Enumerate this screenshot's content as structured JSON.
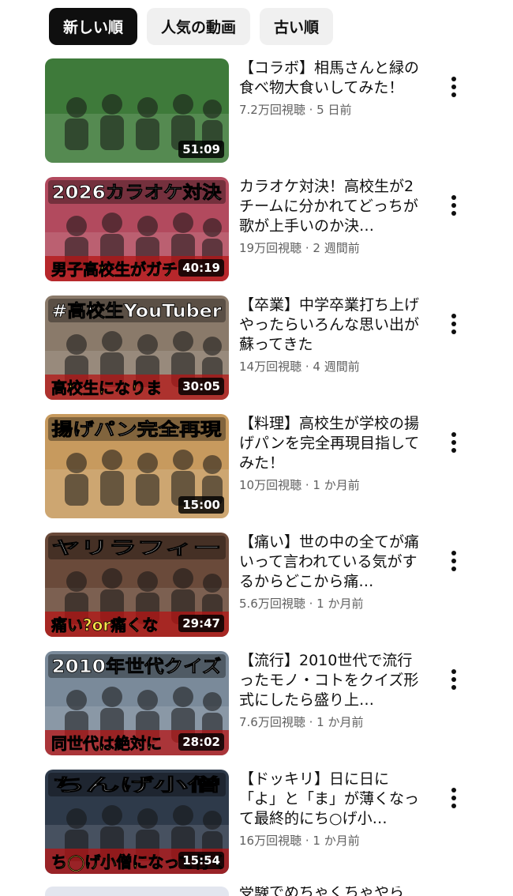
{
  "filters": [
    {
      "label": "新しい順",
      "active": true
    },
    {
      "label": "人気の動画",
      "active": false
    },
    {
      "label": "古い順",
      "active": false
    }
  ],
  "videos": [
    {
      "title": "【コラボ】相馬さんと緑の食べ物大食いしてみた！",
      "views": "7.2万回視聴",
      "age": "5 日前",
      "duration": "51:09",
      "thumb_text": "",
      "thumb_bg": "#3e7a3a"
    },
    {
      "title": "カラオケ対決！高校生が2チームに分かれてどっちが歌が上手いのか決…",
      "views": "19万回視聴",
      "age": "2 週間前",
      "duration": "40:19",
      "thumb_text": "2026カラオケ対決",
      "thumb_bottom": "男子高校生がガチ",
      "thumb_bg": "#b24a5e"
    },
    {
      "title": "【卒業】中学卒業打ち上げやったらいろんな思い出が蘇ってきた",
      "views": "14万回視聴",
      "age": "4 週間前",
      "duration": "30:05",
      "thumb_text": "#高校生YouTuber",
      "thumb_bottom": "高校生になりま",
      "thumb_bg": "#8a7a6a"
    },
    {
      "title": "【料理】高校生が学校の揚げパンを完全再現目指してみた！",
      "views": "10万回視聴",
      "age": "1 か月前",
      "duration": "15:00",
      "thumb_text": "揚げパン完全再現",
      "thumb_bg": "#c79a5e"
    },
    {
      "title": "【痛い】世の中の全てが痛いって言われている気がするからどこから痛…",
      "views": "5.6万回視聴",
      "age": "1 か月前",
      "duration": "29:47",
      "thumb_text": "ヤリラフィー",
      "thumb_bottom": "痛い?or痛くな",
      "thumb_bg": "#6a4a3a"
    },
    {
      "title": "【流行】2010世代で流行ったモノ・コトをクイズ形式にしたら盛り上…",
      "views": "7.6万回視聴",
      "age": "1 か月前",
      "duration": "28:02",
      "thumb_text": "2010年世代クイズ",
      "thumb_bottom": "同世代は絶対に",
      "thumb_bg": "#7a8a9a"
    },
    {
      "title": "【ドッキリ】日に日に「よ」と「ま」が薄くなって最終的にち○げ小…",
      "views": "16万回視聴",
      "age": "1 か月前",
      "duration": "15:54",
      "thumb_text": "ちんげ小僧",
      "thumb_bottom": "ち◯げ小僧になって行く",
      "thumb_bg": "#2e3a4a"
    }
  ],
  "partial_title": "受験でめちゃくちゃやら",
  "colors": {
    "active_chip": "#0f0f0f",
    "chip": "#f0f0f0",
    "secondary_text": "#606060"
  }
}
